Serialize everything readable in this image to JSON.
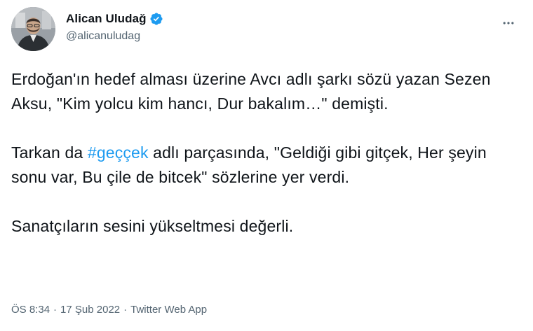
{
  "author": {
    "display_name": "Alican Uludağ",
    "handle": "@alicanuludag",
    "verified_icon": "verified-badge-icon",
    "avatar_icon": "profile-photo"
  },
  "menu": {
    "more_icon": "more-options-icon"
  },
  "tweet": {
    "para1": "Erdoğan'ın hedef alması üzerine Avcı adlı şarkı sözü yazan Sezen Aksu, \"Kim yolcu kim hancı, Dur bakalım…\" demişti.",
    "para2_before": "Tarkan da ",
    "hashtag": "#geççek",
    "para2_after": " adlı parçasında, \"Geldiği gibi gitçek, Her şeyin sonu var, Bu çile de bitcek\" sözlerine yer verdi.",
    "para3": "Sanatçıların sesini yükseltmesi değerli."
  },
  "meta": {
    "time": "ÖS 8:34",
    "separator": "·",
    "date": "17 Şub 2022",
    "source": "Twitter Web App"
  },
  "colors": {
    "text": "#0f1419",
    "secondary": "#536471",
    "accent": "#1d9bf0",
    "background": "#ffffff"
  }
}
